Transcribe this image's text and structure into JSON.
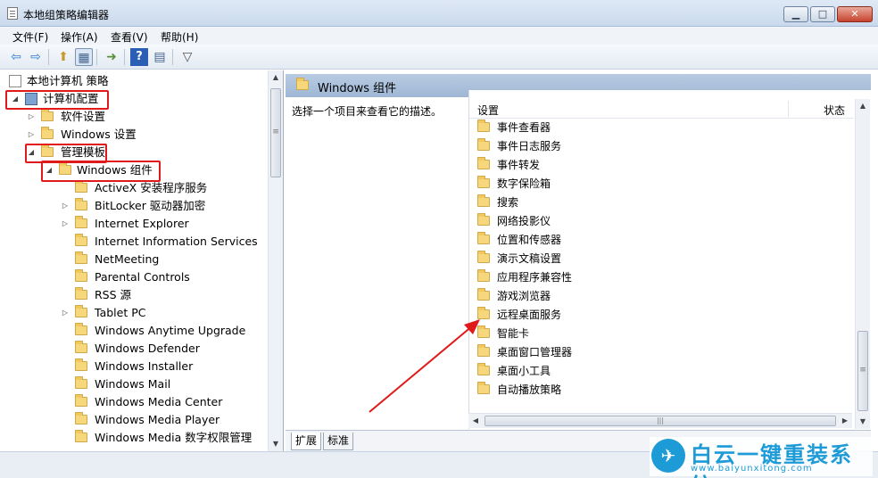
{
  "window": {
    "title": "本地组策略编辑器",
    "minimize": "▁",
    "maximize": "□",
    "close": "✕"
  },
  "menu": [
    "文件(F)",
    "操作(A)",
    "查看(V)",
    "帮助(H)"
  ],
  "toolbar": {
    "icons": [
      "back-arrow-icon",
      "forward-arrow-icon",
      "up-folder-icon",
      "show-hide-tree-icon",
      "export-list-icon",
      "help-icon",
      "properties-icon",
      "filter-icon"
    ],
    "back": "⇦",
    "forward": "⇨",
    "up": "⬆",
    "tree": "▦",
    "export": "➜",
    "help": "?",
    "props": "▤",
    "filter": "▽"
  },
  "tree": {
    "root": "本地计算机 策略",
    "computer_config": "计算机配置",
    "software_settings": "软件设置",
    "windows_settings": "Windows 设置",
    "admin_templates": "管理模板",
    "windows_components": "Windows 组件",
    "children": [
      "ActiveX 安装程序服务",
      "BitLocker 驱动器加密",
      "Internet Explorer",
      "Internet Information Services",
      "NetMeeting",
      "Parental Controls",
      "RSS 源",
      "Tablet PC",
      "Windows Anytime Upgrade",
      "Windows Defender",
      "Windows Installer",
      "Windows Mail",
      "Windows Media Center",
      "Windows Media Player",
      "Windows Media 数字权限管理"
    ],
    "expand_open": "◢",
    "expand_closed": "▷"
  },
  "right": {
    "header_title": "Windows 组件",
    "description": "选择一个项目来查看它的描述。",
    "columns": {
      "setting": "设置",
      "state": "状态"
    },
    "items": [
      "事件查看器",
      "事件日志服务",
      "事件转发",
      "数字保险箱",
      "搜索",
      "网络投影仪",
      "位置和传感器",
      "演示文稿设置",
      "应用程序兼容性",
      "游戏浏览器",
      "远程桌面服务",
      "智能卡",
      "桌面窗口管理器",
      "桌面小工具",
      "自动播放策略"
    ]
  },
  "tabs": {
    "extended": "扩展",
    "standard": "标准"
  },
  "scroll": {
    "up": "▲",
    "down": "▼",
    "left": "◀",
    "right": "▶",
    "grip": "≡",
    "hgrip": "|||"
  },
  "brand": {
    "name": "白云一键重装系统",
    "url": "www.baiyunxitong.com",
    "bird": "✈"
  },
  "colors": {
    "highlight": "#e01a1a",
    "header": "#b8cbe2",
    "brand": "#1d9bd7"
  }
}
